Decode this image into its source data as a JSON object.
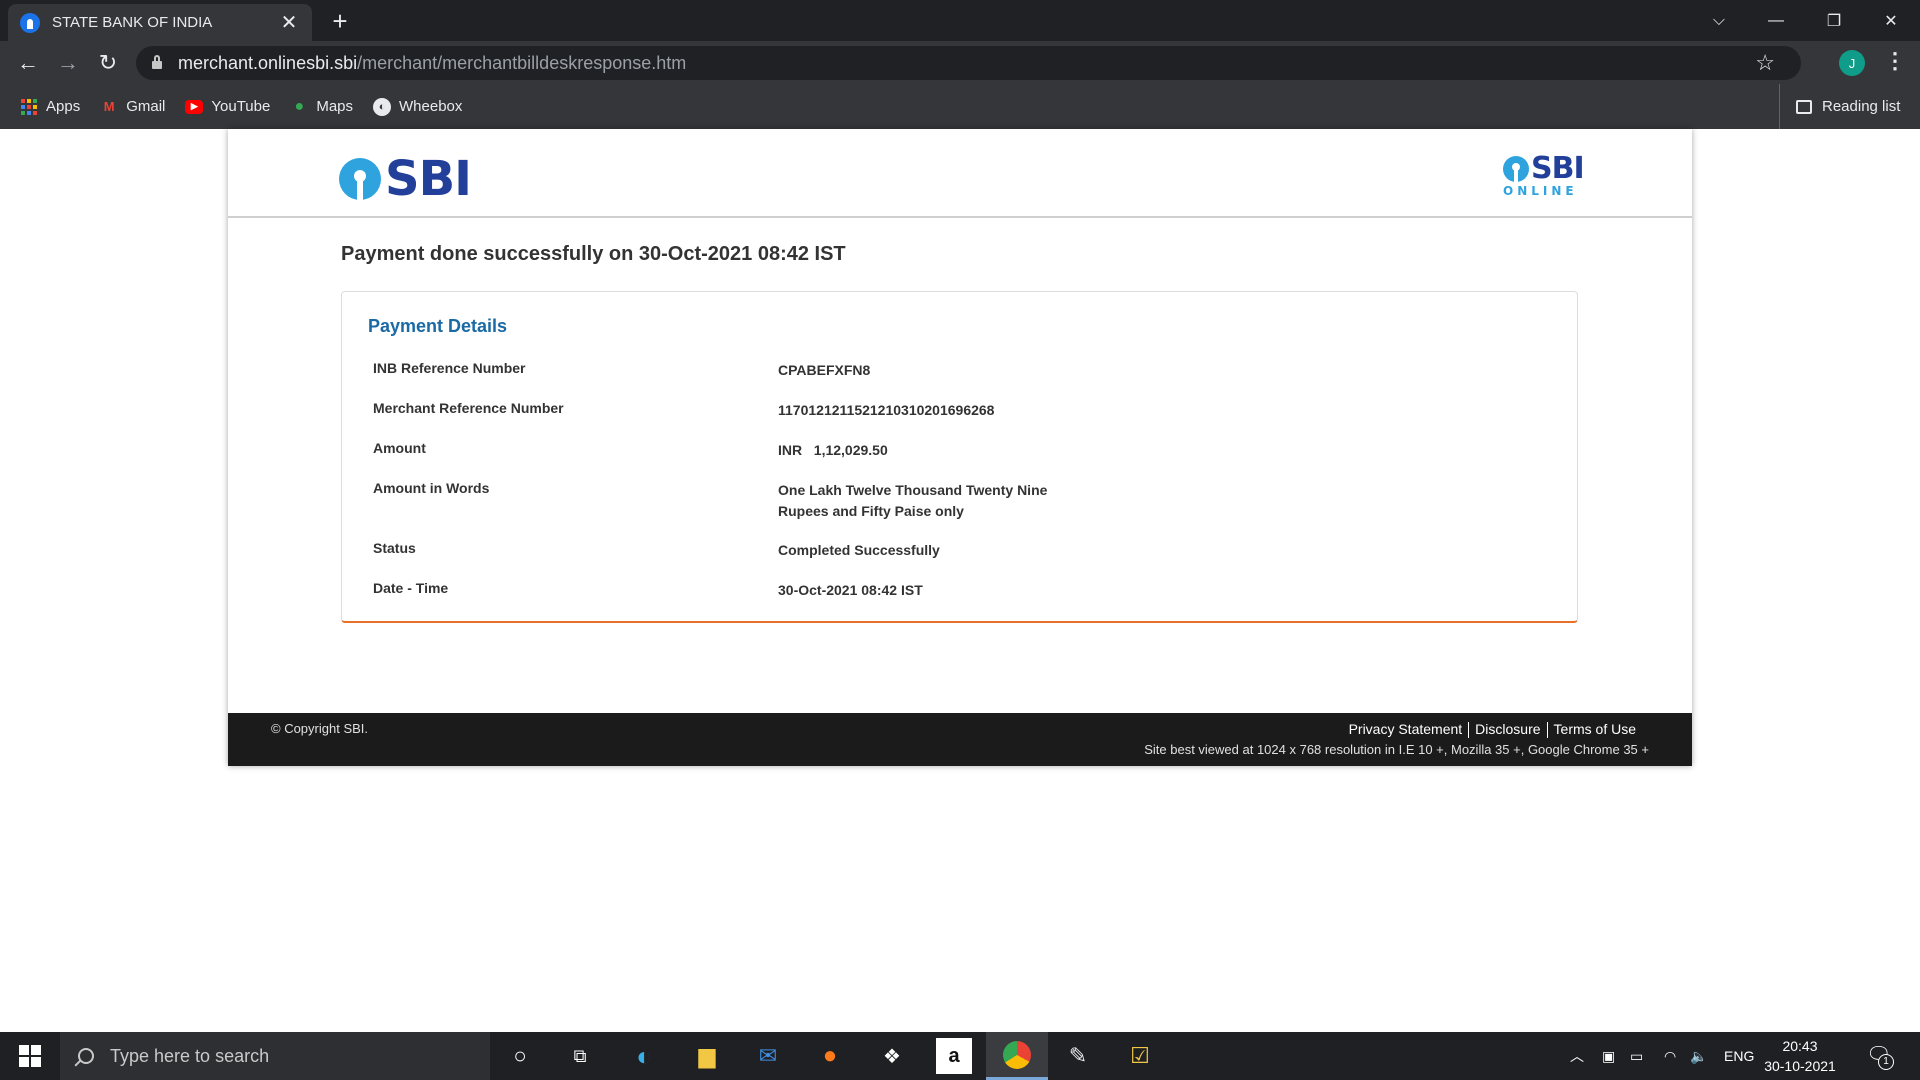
{
  "browser": {
    "tab_title": "STATE BANK OF INDIA",
    "tab_close": "✕",
    "new_tab": "+",
    "url_host": "merchant.onlinesbi.sbi",
    "url_path": "/merchant/merchantbilldeskresponse.htm",
    "profile_initial": "J",
    "bookmarks": [
      {
        "label": "Apps",
        "icon": "apps-grid-icon"
      },
      {
        "label": "Gmail",
        "icon": "gmail-icon"
      },
      {
        "label": "YouTube",
        "icon": "youtube-icon"
      },
      {
        "label": "Maps",
        "icon": "maps-icon"
      },
      {
        "label": "Wheebox",
        "icon": "wheebox-icon"
      }
    ],
    "reading_list": "Reading list"
  },
  "page": {
    "logo_text": "SBI",
    "online_logo_text": "SBI",
    "online_subtext": "ONLINE",
    "success_message": "Payment done successfully on 30-Oct-2021 08:42 IST",
    "details_title": "Payment Details",
    "details": [
      {
        "label": "INB Reference Number",
        "value": "CPABEFXFN8"
      },
      {
        "label": "Merchant Reference Number",
        "value": "117012121152121031020169626​8"
      },
      {
        "label": "Amount",
        "value": "INR   1,12,029.50"
      },
      {
        "label": "Amount in Words",
        "value": "One Lakh Twelve Thousand Twenty Nine Rupees and Fifty Paise only"
      },
      {
        "label": "Status",
        "value": "Completed Successfully"
      },
      {
        "label": "Date - Time",
        "value": "30-Oct-2021 08:42 IST"
      }
    ],
    "footer": {
      "copyright": "© Copyright SBI.",
      "links": [
        "Privacy Statement",
        "Disclosure",
        "Terms of Use"
      ],
      "best_view": "Site best viewed at 1024 x 768 resolution in I.E 10 +, Mozilla 35 +, Google Chrome 35 +"
    }
  },
  "taskbar": {
    "search_placeholder": "Type here to search",
    "lang": "ENG",
    "time": "20:43",
    "date": "30-10-2021",
    "notification_count": "1"
  },
  "colors": {
    "sbi_blue": "#22409a",
    "sbi_light_blue": "#2ea3de",
    "details_title": "#1a6aa5",
    "details_accent": "#e8702a"
  }
}
